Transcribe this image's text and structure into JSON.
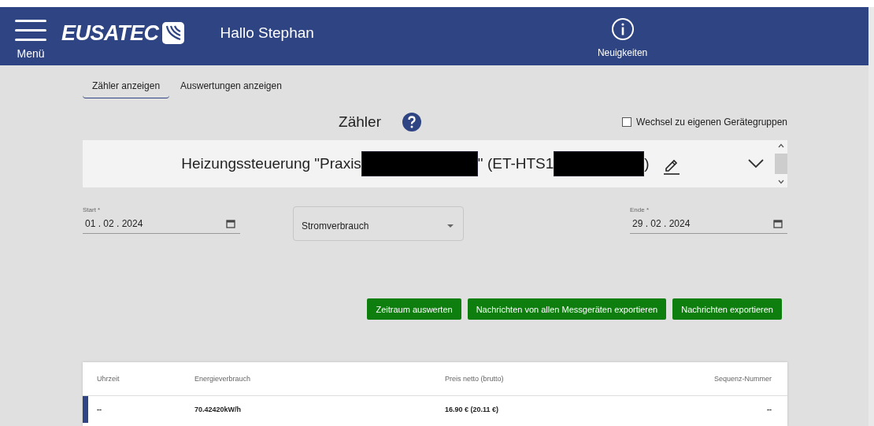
{
  "header": {
    "menu_label": "Menü",
    "logo": "EUSATEC",
    "greeting": "Hallo Stephan",
    "news_label": "Neuigkeiten"
  },
  "tabs": [
    {
      "label": "Zähler anzeigen",
      "selected": true
    },
    {
      "label": "Auswertungen anzeigen",
      "selected": false
    }
  ],
  "title": "Zähler",
  "own_groups_checkbox": {
    "label": "Wechsel zu eigenen Gerätegruppen",
    "checked": false
  },
  "device_selector": {
    "parts": [
      {
        "kind": "text",
        "text": "Heizungssteuerung \"Praxis"
      },
      {
        "kind": "redacted"
      },
      {
        "kind": "text",
        "text": "\" (ET-HTS1"
      },
      {
        "kind": "redacted"
      },
      {
        "kind": "text",
        "text": ")"
      }
    ]
  },
  "start_field": {
    "label": "Start *",
    "value": "01 . 02 . 2024"
  },
  "type_select": {
    "value": "Stromverbrauch"
  },
  "end_field": {
    "label": "Ende *",
    "value": "29 . 02 . 2024"
  },
  "buttons": [
    "Zeitraum auswerten",
    "Nachrichten von allen Messgeräten exportieren",
    "Nachrichten exportieren"
  ],
  "table": {
    "columns": [
      "Uhrzeit",
      "Energieverbrauch",
      "Preis netto (brutto)",
      "Sequenz-Nummer"
    ],
    "rows": [
      {
        "cells": [
          "--",
          "70.42420kW/h",
          "16.90 € (20.11 €)",
          "--"
        ],
        "selected": true
      }
    ]
  }
}
